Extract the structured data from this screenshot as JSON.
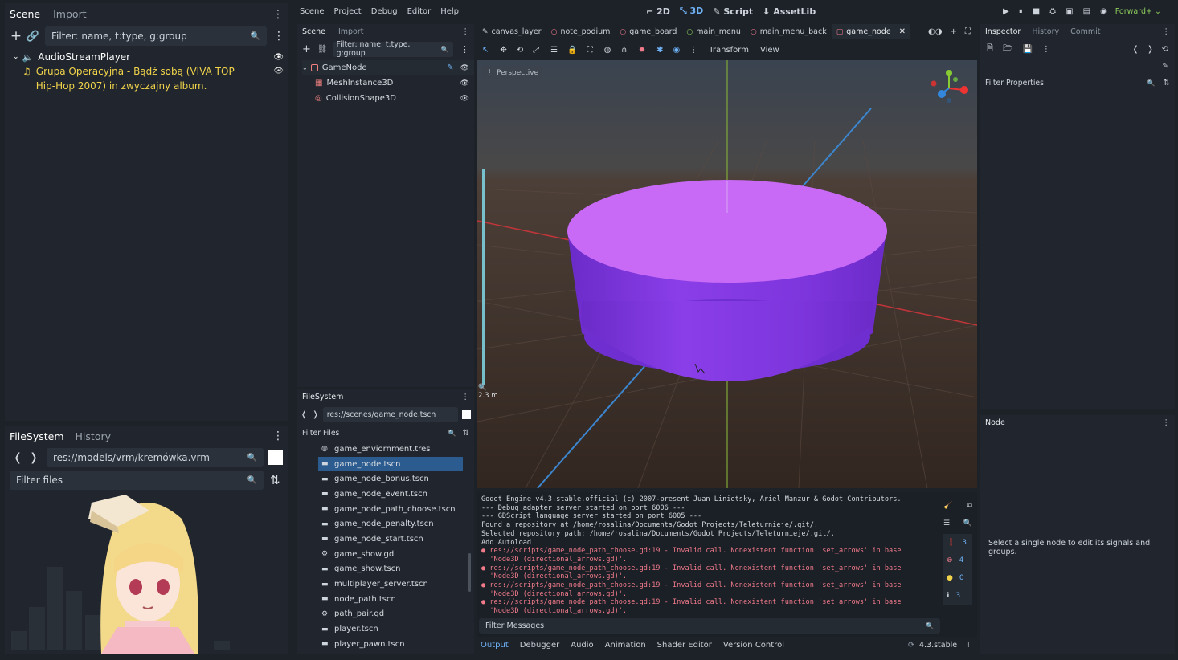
{
  "left_dock": {
    "tabs": [
      "Scene",
      "Import"
    ],
    "filter_placeholder": "Filter: name, t:type, g:group",
    "tree": [
      {
        "label": "AudioStreamPlayer"
      },
      {
        "label": "Grupa Operacyjna - Bądź sobą (VIVA TOP Hip-Hop 2007) in zwyczajny album."
      }
    ],
    "fs_tabs": [
      "FileSystem",
      "History"
    ],
    "fs_path": "res://models/vrm/kremówka.vrm",
    "fs_filter_placeholder": "Filter files"
  },
  "menubar": {
    "items": [
      "Scene",
      "Project",
      "Debug",
      "Editor",
      "Help"
    ],
    "workspaces": [
      "2D",
      "3D",
      "Script",
      "AssetLib"
    ],
    "renderer": "Forward+"
  },
  "scene_dock": {
    "tabs": [
      "Scene",
      "Import"
    ],
    "filter_placeholder": "Filter: name, t:type, g:group",
    "nodes": [
      "GameNode",
      "MeshInstance3D",
      "CollisionShape3D"
    ]
  },
  "filesystem_dock": {
    "title": "FileSystem",
    "path": "res://scenes/game_node.tscn",
    "filter_placeholder": "Filter Files",
    "files": [
      "game_enviornment.tres",
      "game_node.tscn",
      "game_node_bonus.tscn",
      "game_node_event.tscn",
      "game_node_path_choose.tscn",
      "game_node_penalty.tscn",
      "game_node_start.tscn",
      "game_show.gd",
      "game_show.tscn",
      "multiplayer_server.tscn",
      "node_path.tscn",
      "path_pair.gd",
      "player.tscn",
      "player_pawn.tscn"
    ]
  },
  "scene_tabs": [
    "canvas_layer",
    "note_podium",
    "game_board",
    "main_menu",
    "main_menu_back",
    "game_node"
  ],
  "viewport": {
    "toolbar_menus": [
      "Transform",
      "View"
    ],
    "perspective_label": "Perspective",
    "zoom_label": "2.3 m"
  },
  "console": {
    "lines": [
      {
        "text": "Godot Engine v4.3.stable.official (c) 2007-present Juan Linietsky, Ariel Manzur & Godot Contributors.",
        "type": "info"
      },
      {
        "text": "--- Debug adapter server started on port 6006 ---",
        "type": "info"
      },
      {
        "text": "--- GDScript language server started on port 6005 ---",
        "type": "info"
      },
      {
        "text": "Found a repository at /home/rosalina/Documents/Godot Projects/Teleturnieje/.git/.",
        "type": "info"
      },
      {
        "text": "Selected repository path: /home/rosalina/Documents/Godot Projects/Teleturnieje/.git/.",
        "type": "info"
      },
      {
        "text": "Add Autoload",
        "type": "info"
      },
      {
        "text": "● res://scripts/game_node_path_choose.gd:19 - Invalid call. Nonexistent function 'set_arrows' in base",
        "type": "error"
      },
      {
        "text": "  'Node3D (directional_arrows.gd)'.",
        "type": "error"
      },
      {
        "text": "● res://scripts/game_node_path_choose.gd:19 - Invalid call. Nonexistent function 'set_arrows' in base",
        "type": "error"
      },
      {
        "text": "  'Node3D (directional_arrows.gd)'.",
        "type": "error"
      },
      {
        "text": "● res://scripts/game_node_path_choose.gd:19 - Invalid call. Nonexistent function 'set_arrows' in base",
        "type": "error"
      },
      {
        "text": "  'Node3D (directional_arrows.gd)'.",
        "type": "error"
      },
      {
        "text": "● res://scripts/game_node_path_choose.gd:19 - Invalid call. Nonexistent function 'set_arrows' in base",
        "type": "error"
      },
      {
        "text": "  'Node3D (directional_arrows.gd)'.",
        "type": "error"
      }
    ],
    "filter_placeholder": "Filter Messages",
    "counts": {
      "messages": "3",
      "errors": "4",
      "warnings": "0",
      "info": "3"
    }
  },
  "bottom_tabs": [
    "Output",
    "Debugger",
    "Audio",
    "Animation",
    "Shader Editor",
    "Version Control"
  ],
  "version": "4.3.stable",
  "inspector": {
    "tabs": [
      "Inspector",
      "History",
      "Commit"
    ],
    "filter_placeholder": "Filter Properties",
    "node_tab": "Node",
    "node_message": "Select a single node to edit its signals and groups."
  },
  "colors": {
    "accent": "#4a9be8",
    "cylinder_top": "#c86af5",
    "cylinder_side": "#8a3ee8",
    "error": "#f07a8a",
    "song_text": "#f0d34a"
  }
}
